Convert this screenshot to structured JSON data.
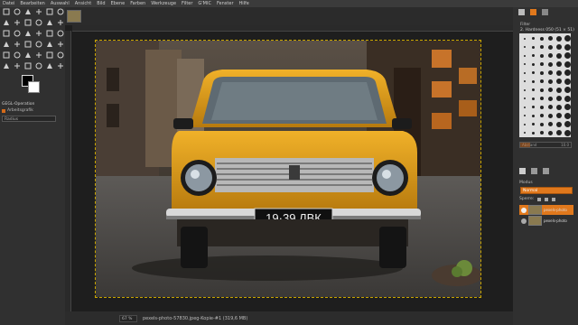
{
  "menu": [
    "Datei",
    "Bearbeiten",
    "Auswahl",
    "Ansicht",
    "Bild",
    "Ebene",
    "Farben",
    "Werkzeuge",
    "Filter",
    "G'MIC",
    "Fenster",
    "Hilfe"
  ],
  "toolbox": {
    "tool_icons": [
      "rect-select-icon",
      "ellipse-select-icon",
      "free-select-icon",
      "fuzzy-select-icon",
      "color-select-icon",
      "scissors-icon",
      "foreground-select-icon",
      "paths-icon",
      "color-picker-icon",
      "zoom-icon",
      "measure-icon",
      "move-icon",
      "align-icon",
      "crop-icon",
      "rotate-icon",
      "scale-icon",
      "shear-icon",
      "perspective-icon",
      "flip-icon",
      "cage-icon",
      "warp-icon",
      "text-icon",
      "bucket-fill-icon",
      "gradient-icon",
      "pencil-icon",
      "paintbrush-icon",
      "eraser-icon",
      "airbrush-icon",
      "ink-icon",
      "mypaint-icon",
      "clone-icon",
      "heal-icon",
      "perspective-clone-icon",
      "blur-icon",
      "smudge-icon",
      "dodge-icon"
    ],
    "options_title": "GEGL-Operation",
    "options_checkbox": "Arbeitsgrafik",
    "options_select": "Radius"
  },
  "canvas": {
    "license_plate": "19·39 ЛВК"
  },
  "status": {
    "zoom": "67 %",
    "file": "pexels-photo-57830.jpeg-Kopie-#1 (319,6 MB)"
  },
  "right_dock": {
    "brush_section": "Filter",
    "brush_name": "2. Hardness 050 (51 × 51)",
    "spacing_label": "Abstand",
    "spacing_value": "10.0",
    "spacing_fraction": 0.2,
    "mode_label": "Modus",
    "mode_value": "Normal",
    "lock_label": "Sperre:",
    "layers": [
      {
        "name": "pexels-photo",
        "selected": true
      },
      {
        "name": "pexels-photo",
        "selected": false
      }
    ]
  },
  "colors": {
    "accent": "#e0781c",
    "fg_color": "#000000",
    "bg_color": "#ffffff"
  }
}
